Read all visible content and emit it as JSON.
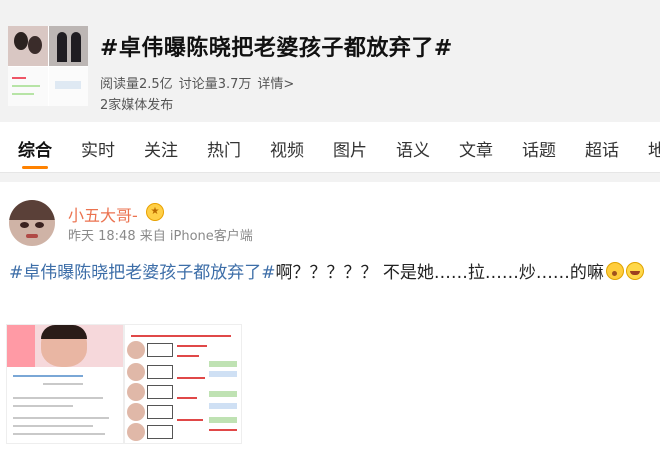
{
  "topic": {
    "title": "#卓伟曝陈晓把老婆孩子都放弃了#",
    "read_count": "阅读量2.5亿",
    "comment_count": "讨论量3.7万",
    "detail_link": "详情>",
    "source": "2家媒体发布"
  },
  "tabs": [
    {
      "label": "综合"
    },
    {
      "label": "实时"
    },
    {
      "label": "关注"
    },
    {
      "label": "热门"
    },
    {
      "label": "视频"
    },
    {
      "label": "图片"
    },
    {
      "label": "语义"
    },
    {
      "label": "文章"
    },
    {
      "label": "话题"
    },
    {
      "label": "超话"
    },
    {
      "label": "地"
    }
  ],
  "post": {
    "username": "小五大哥-",
    "time": "昨天 18:48",
    "client": "来自 iPhone客户端",
    "hashtag": "#卓伟曝陈晓把老婆孩子都放弃了#",
    "text": "啊？？？？？ 不是她……拉……炒……的嘛",
    "emojis": [
      "surprise-emoji",
      "laugh-emoji"
    ]
  },
  "colors": {
    "accent": "#ff8200",
    "username": "#eb7350",
    "hashtag": "#3d6ea8",
    "background": "#f2f2f2"
  }
}
